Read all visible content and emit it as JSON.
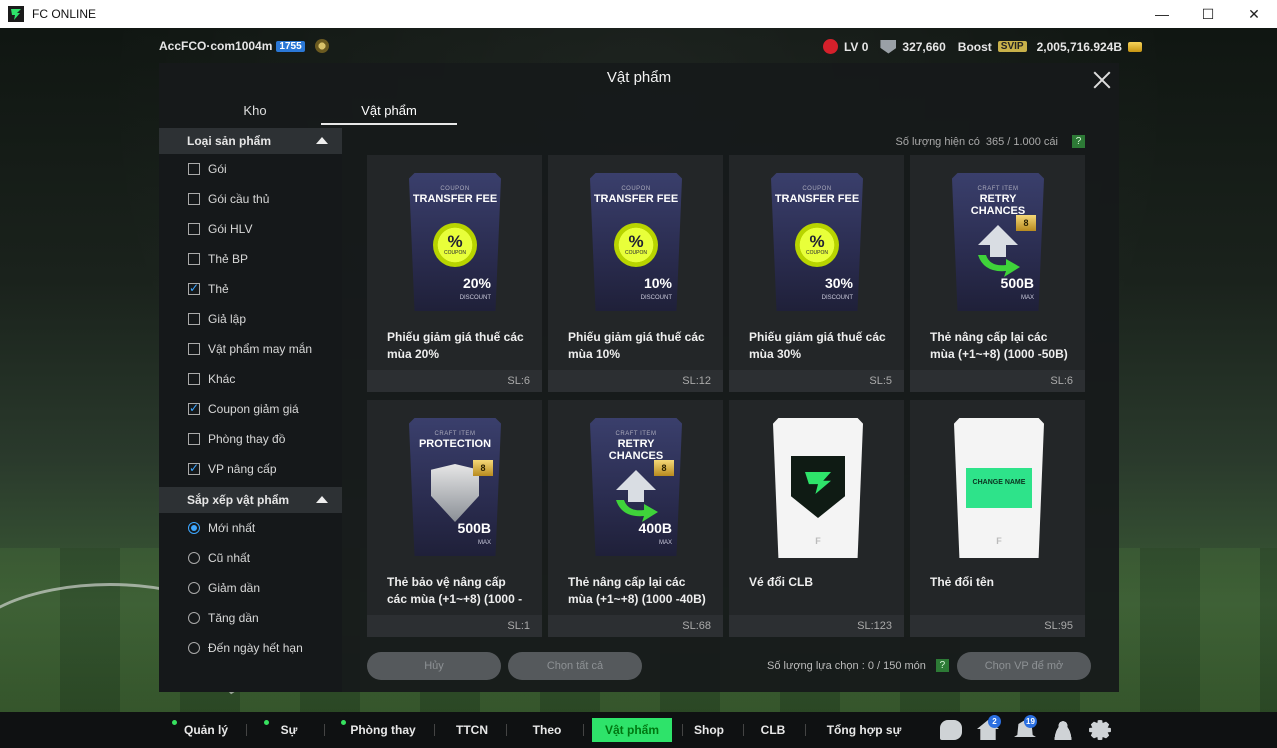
{
  "window": {
    "title": "FC ONLINE",
    "minimize": "—",
    "maximize": "☐",
    "close": "✕"
  },
  "account": {
    "name": "AccFCO·com1004m",
    "level_badge": "1755"
  },
  "stats": {
    "lv": "LV 0",
    "points": "327,660",
    "boost": "Boost",
    "svip": "SVIP",
    "gold": "2,005,716.924B"
  },
  "modal": {
    "title": "Vật phẩm",
    "tabs": [
      "Kho",
      "Vật phẩm"
    ],
    "capacity_label": "Số lượng hiện có",
    "capacity_value": "365 / 1.000 cái",
    "help": "?"
  },
  "filters": {
    "category_header": "Loại sản phẩm",
    "categories": [
      {
        "label": "Gói",
        "checked": false
      },
      {
        "label": "Gói cầu thủ",
        "checked": false
      },
      {
        "label": "Gói HLV",
        "checked": false
      },
      {
        "label": "Thẻ BP",
        "checked": false
      },
      {
        "label": "Thẻ",
        "checked": true
      },
      {
        "label": "Giả lập",
        "checked": false
      },
      {
        "label": "Vật phẩm may mắn",
        "checked": false
      },
      {
        "label": "Khác",
        "checked": false
      },
      {
        "label": "Coupon giảm giá",
        "checked": true
      },
      {
        "label": "Phòng thay đồ",
        "checked": false
      },
      {
        "label": "VP nâng cấp",
        "checked": true
      }
    ],
    "sort_header": "Sắp xếp vật phẩm",
    "sorts": [
      {
        "label": "Mới nhất",
        "selected": true
      },
      {
        "label": "Cũ nhất",
        "selected": false
      },
      {
        "label": "Giảm dần",
        "selected": false
      },
      {
        "label": "Tăng dần",
        "selected": false
      },
      {
        "label": "Đến ngày hết hạn",
        "selected": false
      }
    ]
  },
  "items": [
    {
      "name": "Phiếu giảm giá thuế các mùa 20%",
      "qty": "SL:6",
      "card_sub": "COUPON",
      "card_title": "TRANSFER FEE",
      "val": "20%",
      "val_sub": "DISCOUNT",
      "icon": "coupon-icon"
    },
    {
      "name": "Phiếu giảm giá thuế các mùa 10%",
      "qty": "SL:12",
      "card_sub": "COUPON",
      "card_title": "TRANSFER FEE",
      "val": "10%",
      "val_sub": "DISCOUNT",
      "icon": "coupon-icon"
    },
    {
      "name": "Phiếu giảm giá thuế các mùa 30%",
      "qty": "SL:5",
      "card_sub": "COUPON",
      "card_title": "TRANSFER FEE",
      "val": "30%",
      "val_sub": "DISCOUNT",
      "icon": "coupon-icon"
    },
    {
      "name": "Thẻ nâng cấp lại các mùa (+1~+8) (1000 -50B)",
      "qty": "SL:6",
      "card_sub": "CRAFT ITEM",
      "card_title": "RETRY CHANCES",
      "val": "500B",
      "val_sub": "MAX",
      "icon": "retry-arrow-icon"
    },
    {
      "name": "Thẻ bảo vệ nâng cấp các mùa (+1~+8) (1000 -",
      "qty": "SL:1",
      "card_sub": "CRAFT ITEM",
      "card_title": "PROTECTION",
      "val": "500B",
      "val_sub": "MAX",
      "icon": "shield-item-icon"
    },
    {
      "name": "Thẻ nâng cấp lại các mùa (+1~+8) (1000 -40B)",
      "qty": "SL:68",
      "card_sub": "CRAFT ITEM",
      "card_title": "RETRY CHANCES",
      "val": "400B",
      "val_sub": "MAX",
      "icon": "retry-arrow-icon"
    },
    {
      "name": "Vé đổi CLB",
      "qty": "SL:123",
      "icon": "club-change-icon"
    },
    {
      "name": "Thẻ đổi tên",
      "qty": "SL:95",
      "icon": "name-change-icon"
    }
  ],
  "card_labels": {
    "coupon_word": "COUPON",
    "upgrade_badge": "8",
    "change_name": "CHANGE NAME"
  },
  "footer": {
    "cancel": "Hủy",
    "select_all": "Chọn tất cả",
    "select_count": "Số lượng lựa chọn : 0 / 150 món",
    "open": "Chọn VP để mở"
  },
  "nav": {
    "items": [
      "Quản lý CT",
      "Sự kiện",
      "Phòng thay đồ",
      "TTCN",
      "Theo dõi",
      "Vật phẩm",
      "Shop",
      "CLB",
      "Tổng hợp sự kiện"
    ],
    "active": "Vật phẩm",
    "home_badge": "2",
    "bell_badge": "19"
  },
  "colors": {
    "accent": "#2ee36a",
    "checkbox": "#3ea7ff",
    "svip": "#c8b14a"
  }
}
